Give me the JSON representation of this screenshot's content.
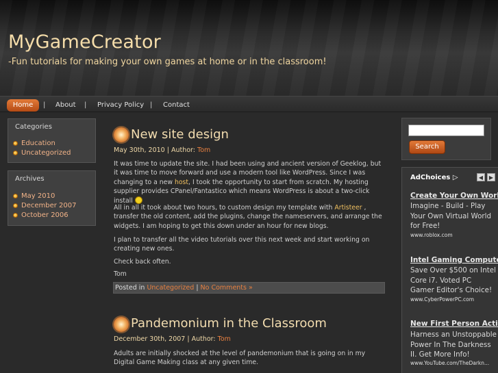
{
  "site": {
    "title": "MyGameCreator",
    "tagline": "-Fun tutorials for making your own games at home or in the classroom!"
  },
  "nav": {
    "items": [
      "Home",
      "About",
      "Privacy Policy",
      "Contact"
    ],
    "separator": "|"
  },
  "sidebar": {
    "categories": {
      "title": "Categories",
      "items": [
        "Education",
        "Uncategorized"
      ]
    },
    "archives": {
      "title": "Archives",
      "items": [
        "May 2010",
        "December 2007",
        "October 2006"
      ]
    }
  },
  "posts": [
    {
      "title": "New site design",
      "date": "May 30th, 2010",
      "author_label": "| Author:",
      "author": "Tom",
      "p1_a": "It was time to update the site. I had been using and ancient version of Geeklog, but it was time to move forward and use a modern tool like WordPress. Since I was changing to a new ",
      "p1_link": "host",
      "p1_b": ", I took the opportunity to start from scratch. My hosting supplier provides CPanel/Fantastico which means WordPress is about a two-click install ",
      "p2_a": "All in all it took about two hours, to custom design my template with ",
      "p2_link": "Artisteer",
      "p2_b": " , transfer the old content, add the plugins, change the nameservers, and arrange the widgets. I am hoping to get this down under an hour for new blogs.",
      "p3": "I plan to transfer all the video tutorials over this next week and start working on creating new ones.",
      "p4": "Check back often.",
      "p5": "Tom",
      "footer_prefix": "Posted in ",
      "footer_category": "Uncategorized",
      "footer_sep": " | ",
      "footer_comments": "No Comments »"
    },
    {
      "title": "Pandemonium in the Classroom",
      "date": "December 30th, 2007",
      "author_label": "| Author:",
      "author": "Tom",
      "p1": "Adults are initially shocked at the level of pandemonium that is going on in my Digital Game Making class at any given time."
    }
  ],
  "search": {
    "button_label": "Search",
    "value": ""
  },
  "ads": {
    "choices_label": "AdChoices",
    "items": [
      {
        "title": "Create Your Own World",
        "body": "Imagine - Build - Play Your Own Virtual World for Free!",
        "url": "www.roblox.com"
      },
      {
        "title": "Intel Gaming Computer",
        "body": "Save Over $500 on Intel Core i7. Voted PC Gamer Editor's Choice!",
        "url": "www.CyberPowerPC.com"
      },
      {
        "title": "New First Person Action",
        "body": "Harness an Unstoppable Power In The Darkness II. Get More Info!",
        "url": "www.YouTube.com/TheDarkn..."
      }
    ]
  },
  "colors": {
    "accent": "#e27a38",
    "title_text": "#f5ddaa",
    "link": "#f0c060",
    "background": "#2a2a2a"
  }
}
